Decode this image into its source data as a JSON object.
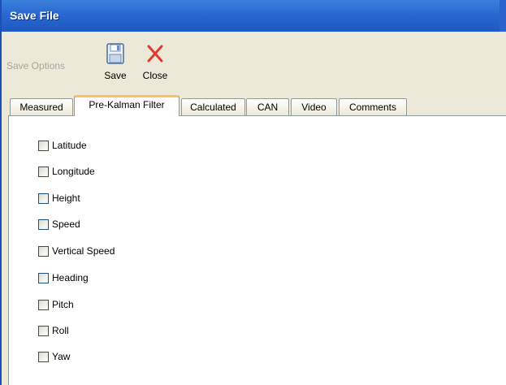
{
  "window": {
    "title": "Save File"
  },
  "toolbar": {
    "save_options_label": "Save Options",
    "save_label": "Save",
    "close_label": "Close"
  },
  "tabs": [
    {
      "label": "Measured",
      "active": false
    },
    {
      "label": "Pre-Kalman Filter",
      "active": true
    },
    {
      "label": "Calculated",
      "active": false
    },
    {
      "label": "CAN",
      "active": false
    },
    {
      "label": "Video",
      "active": false
    },
    {
      "label": "Comments",
      "active": false
    }
  ],
  "options": [
    {
      "label": "Latitude",
      "checked": false
    },
    {
      "label": "Longitude",
      "checked": false
    },
    {
      "label": "Height",
      "checked": false
    },
    {
      "label": "Speed",
      "checked": false
    },
    {
      "label": "Vertical Speed",
      "checked": false
    },
    {
      "label": "Heading",
      "checked": false
    },
    {
      "label": "Pitch",
      "checked": false
    },
    {
      "label": "Roll",
      "checked": false
    },
    {
      "label": "Yaw",
      "checked": false
    }
  ],
  "colors": {
    "titlebar": "#2a68d0",
    "toolbar_bg": "#ece9d8",
    "active_tab_accent": "#f7c35b",
    "close_icon": "#e03a2b"
  }
}
